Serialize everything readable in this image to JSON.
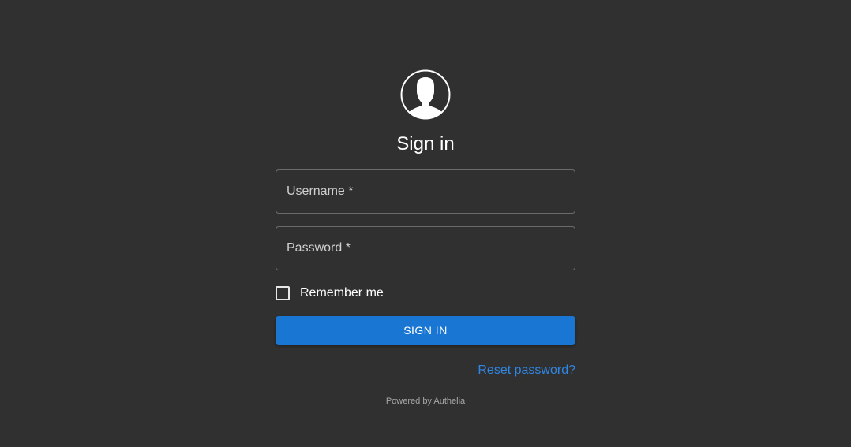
{
  "login": {
    "avatar_icon": "user-circle-icon",
    "title": "Sign in",
    "username_label": "Username *",
    "password_label": "Password *",
    "remember_label": "Remember me",
    "remember_checked": false,
    "signin_label": "SIGN IN",
    "reset_label": "Reset password?",
    "powered_by": "Powered by Authelia"
  },
  "colors": {
    "background": "#303030",
    "accent": "#1976d2",
    "link": "#2f86e3"
  }
}
